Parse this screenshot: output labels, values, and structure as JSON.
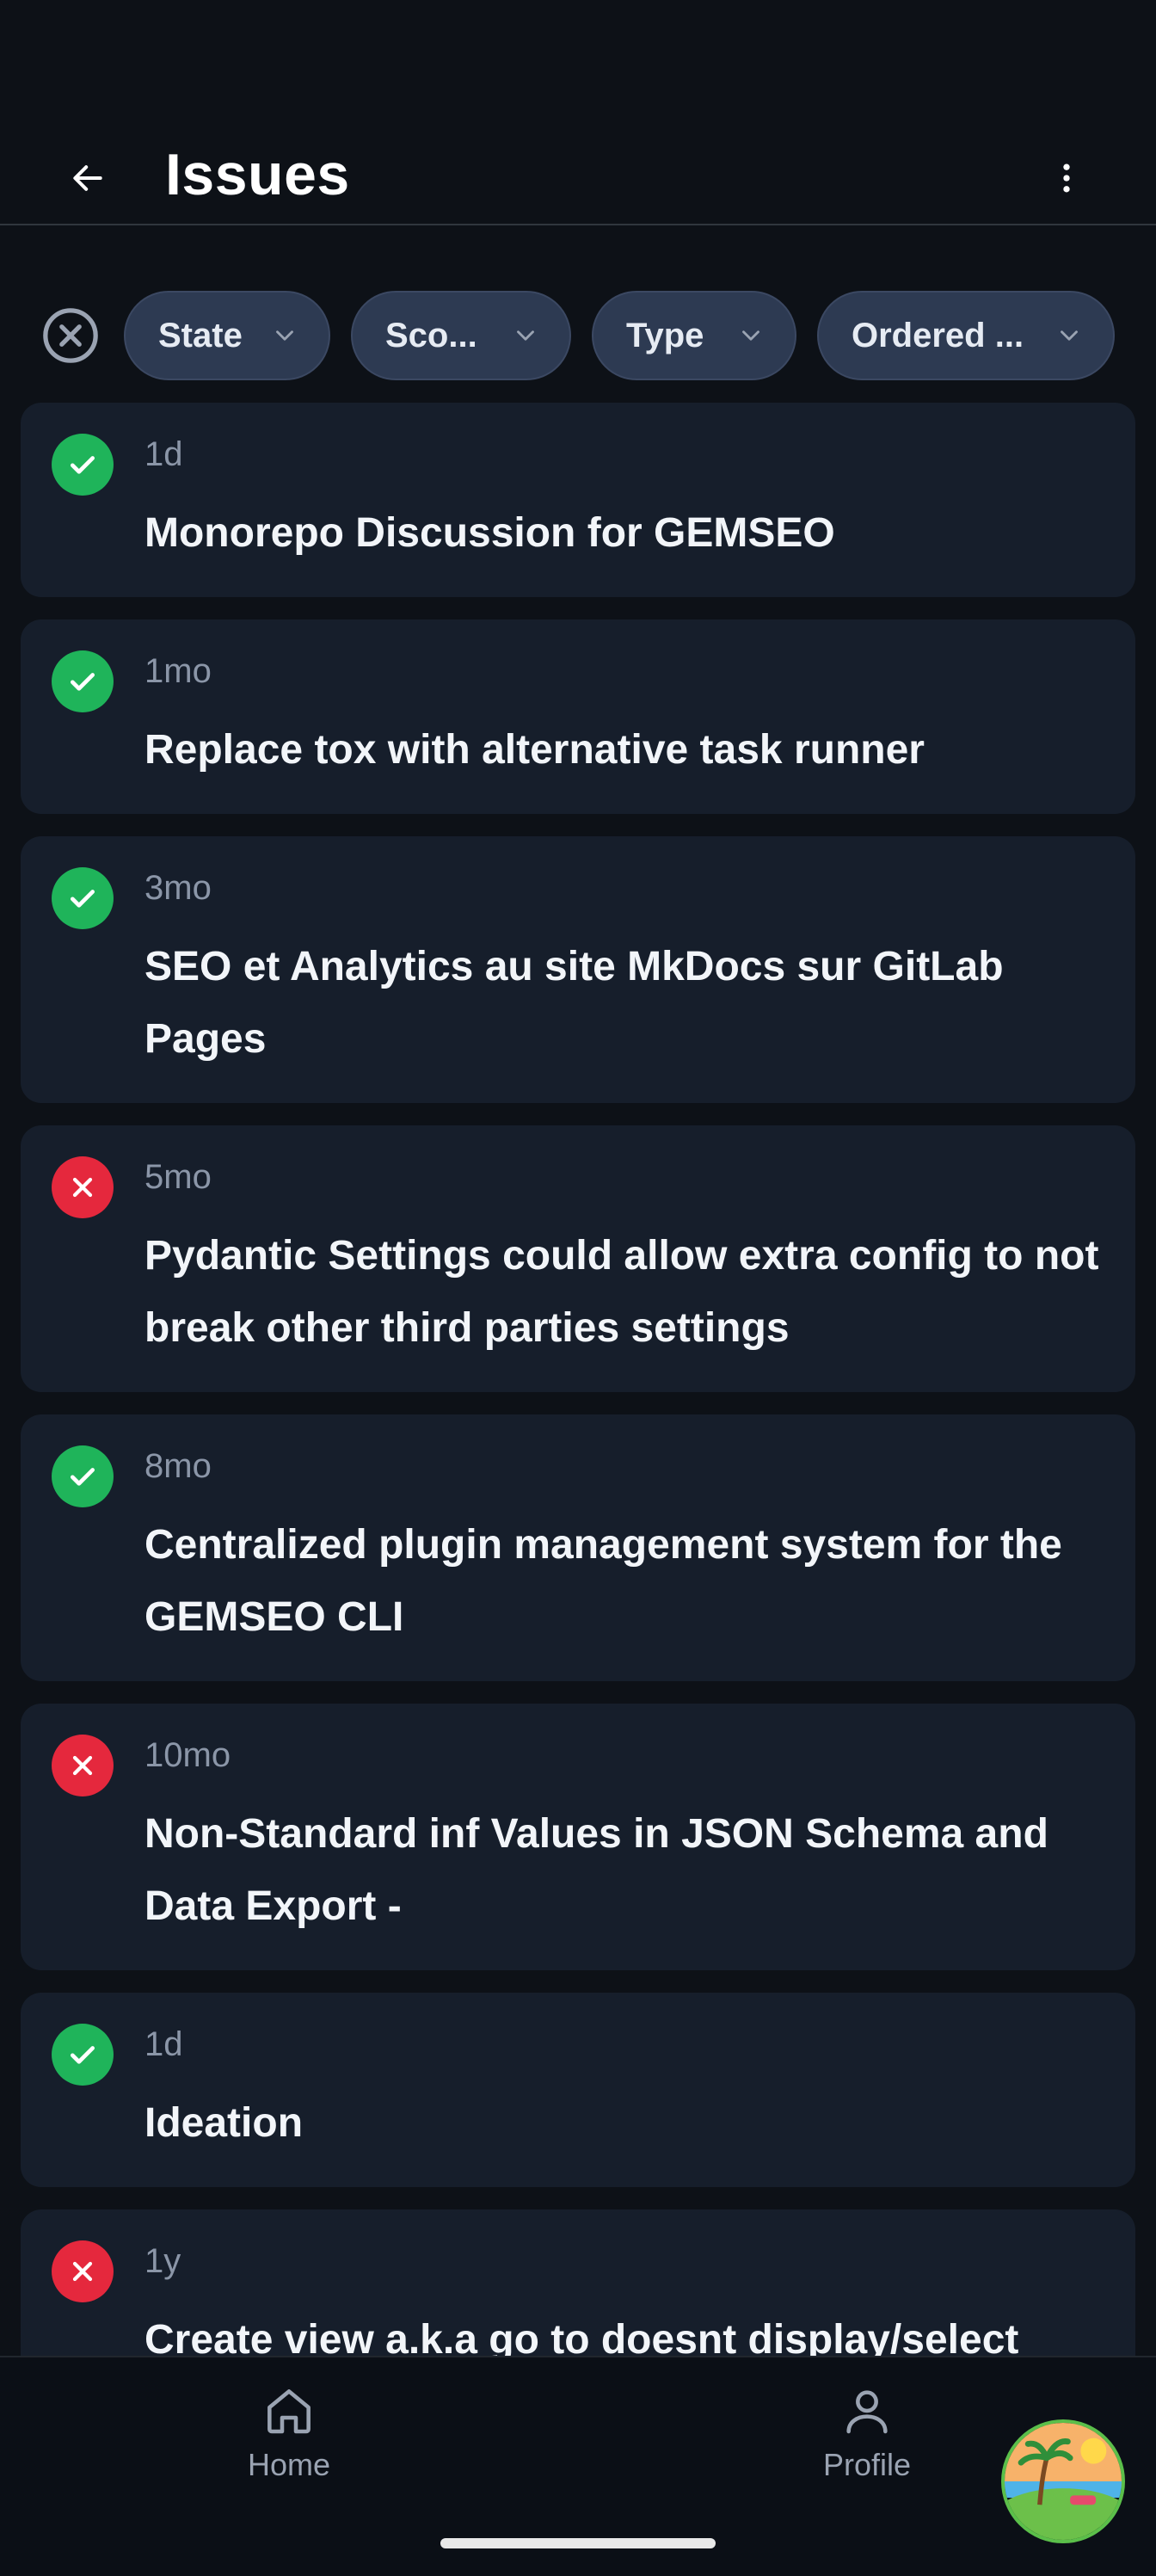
{
  "appbar": {
    "title": "Issues"
  },
  "filters": [
    {
      "label": "State"
    },
    {
      "label": "Sco..."
    },
    {
      "label": "Type"
    },
    {
      "label": "Ordered ..."
    }
  ],
  "issues": [
    {
      "age": "1d",
      "title": "Monorepo Discussion for GEMSEO",
      "status": "open"
    },
    {
      "age": "1mo",
      "title": "Replace tox with alternative task runner",
      "status": "open"
    },
    {
      "age": "3mo",
      "title": "SEO et Analytics au site MkDocs sur GitLab Pages",
      "status": "open"
    },
    {
      "age": "5mo",
      "title": "Pydantic Settings could allow extra config to not break other third parties settings",
      "status": "closed"
    },
    {
      "age": "8mo",
      "title": "Centralized plugin management system for the GEMSEO CLI",
      "status": "open"
    },
    {
      "age": "10mo",
      "title": "Non-Standard inf Values in JSON Schema and Data Export -",
      "status": "closed"
    },
    {
      "age": "1d",
      "title": "Ideation",
      "status": "open"
    },
    {
      "age": "1y",
      "title": "Create view a.k.a go to doesnt display/select",
      "status": "closed"
    }
  ],
  "bottom_nav": {
    "home_label": "Home",
    "profile_label": "Profile"
  },
  "colors": {
    "background": "#0d1117",
    "card": "#161e2b",
    "chip": "#2d3a52",
    "open": "#1fb45a",
    "closed": "#e5283d"
  },
  "icons": {
    "back": "arrow-left-icon",
    "more": "more-vert-icon",
    "clear": "clear-circle-icon",
    "chevron": "chevron-down-icon",
    "open": "check-icon",
    "closed": "close-icon",
    "home": "home-icon",
    "profile": "person-icon"
  }
}
